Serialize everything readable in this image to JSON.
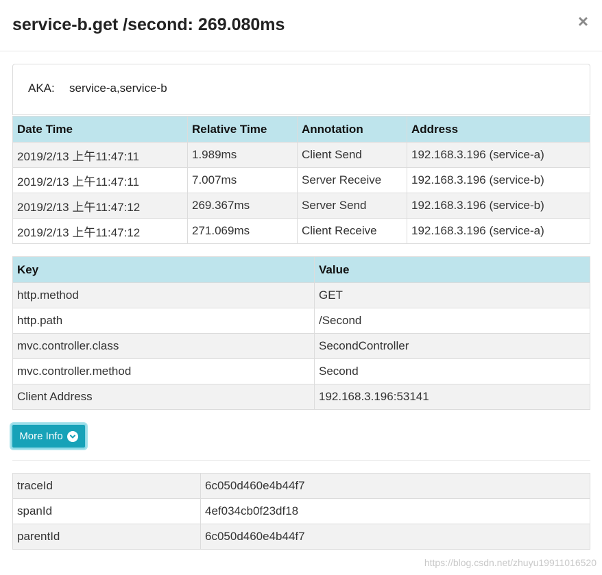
{
  "modal": {
    "title": "service-b.get /second: 269.080ms",
    "close_label": "×"
  },
  "aka": {
    "label": "AKA:",
    "value": "service-a,service-b"
  },
  "annotations": {
    "headers": [
      "Date Time",
      "Relative Time",
      "Annotation",
      "Address"
    ],
    "rows": [
      [
        "2019/2/13 上午11:47:11",
        "1.989ms",
        "Client Send",
        "192.168.3.196 (service-a)"
      ],
      [
        "2019/2/13 上午11:47:11",
        "7.007ms",
        "Server Receive",
        "192.168.3.196 (service-b)"
      ],
      [
        "2019/2/13 上午11:47:12",
        "269.367ms",
        "Server Send",
        "192.168.3.196 (service-b)"
      ],
      [
        "2019/2/13 上午11:47:12",
        "271.069ms",
        "Client Receive",
        "192.168.3.196 (service-a)"
      ]
    ]
  },
  "tags": {
    "headers": [
      "Key",
      "Value"
    ],
    "rows": [
      [
        "http.method",
        "GET"
      ],
      [
        "http.path",
        "/Second"
      ],
      [
        "mvc.controller.class",
        "SecondController"
      ],
      [
        "mvc.controller.method",
        "Second"
      ],
      [
        "Client Address",
        "192.168.3.196:53141"
      ]
    ]
  },
  "more_info": {
    "label": "More Info",
    "icon": "chevron-down-circle-icon",
    "accent": "#17a2b8"
  },
  "ids": {
    "rows": [
      [
        "traceId",
        "6c050d460e4b44f7"
      ],
      [
        "spanId",
        "4ef034cb0f23df18"
      ],
      [
        "parentId",
        "6c050d460e4b44f7"
      ]
    ]
  },
  "watermark": "https://blog.csdn.net/zhuyu19911016520",
  "colors": {
    "header_bg": "#bee4ec",
    "row_odd_bg": "#f2f2f2",
    "button_bg": "#17a2b8"
  }
}
